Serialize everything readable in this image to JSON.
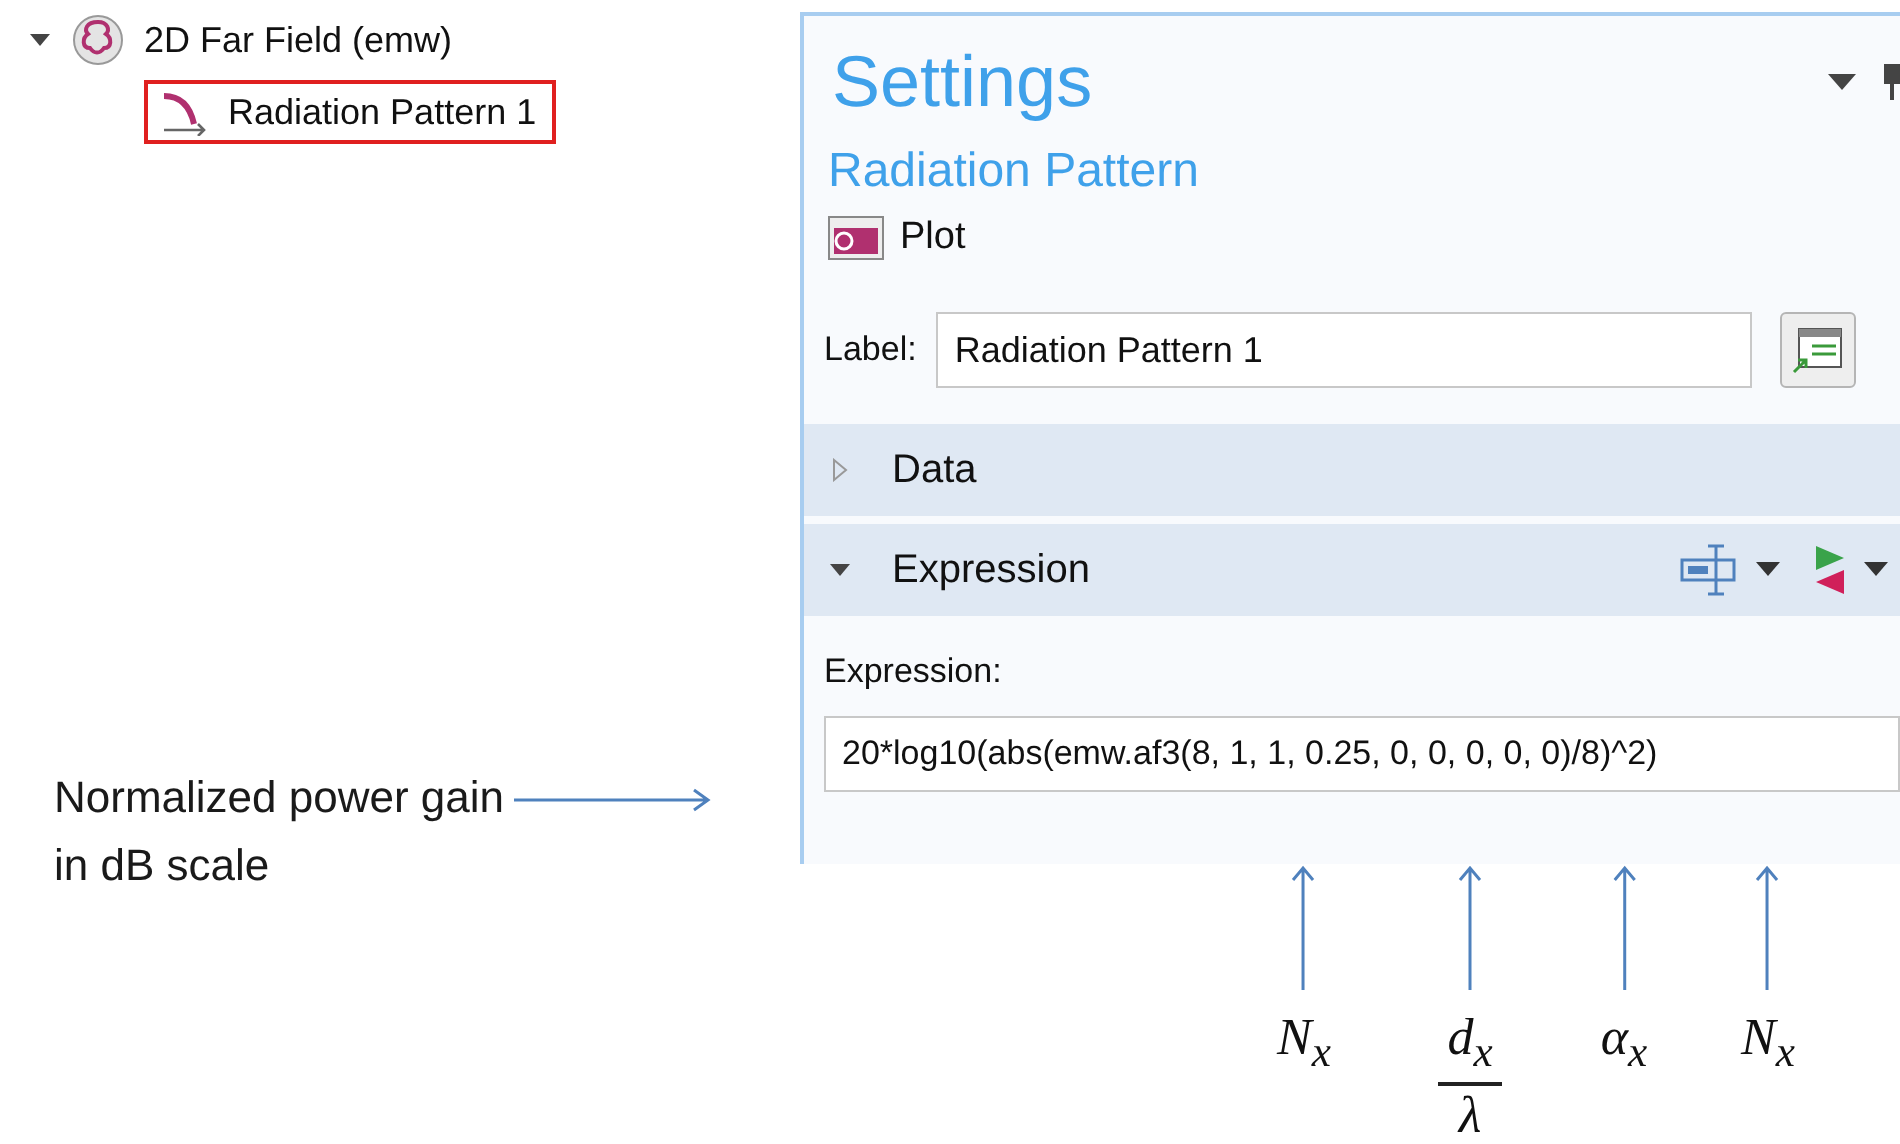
{
  "tree": {
    "expanded": true,
    "label": "2D Far Field (emw)",
    "children": [
      {
        "label": "Radiation Pattern 1",
        "selected": true
      }
    ]
  },
  "settings": {
    "title": "Settings",
    "subtitle": "Radiation Pattern",
    "type": "Plot",
    "label_field": {
      "label": "Label:",
      "value": "Radiation Pattern 1"
    },
    "sections": [
      {
        "title": "Data",
        "expanded": false
      },
      {
        "title": "Expression",
        "expanded": true,
        "field": {
          "label": "Expression:",
          "value": "20*log10(abs(emw.af3(8, 1, 1, 0.25, 0, 0, 0, 0, 0)/8)^2)"
        }
      }
    ]
  },
  "annotations": {
    "note": "Normalized power gain\nin dB scale",
    "parameters": [
      {
        "kind": "symbol",
        "text": "N$_{x}$"
      },
      {
        "kind": "fraction",
        "numerator": "d$_{x}$",
        "denominator": "λ"
      },
      {
        "kind": "symbol",
        "text": "α$_{x}$"
      },
      {
        "kind": "symbol",
        "text": "N$_{x}$"
      }
    ]
  }
}
